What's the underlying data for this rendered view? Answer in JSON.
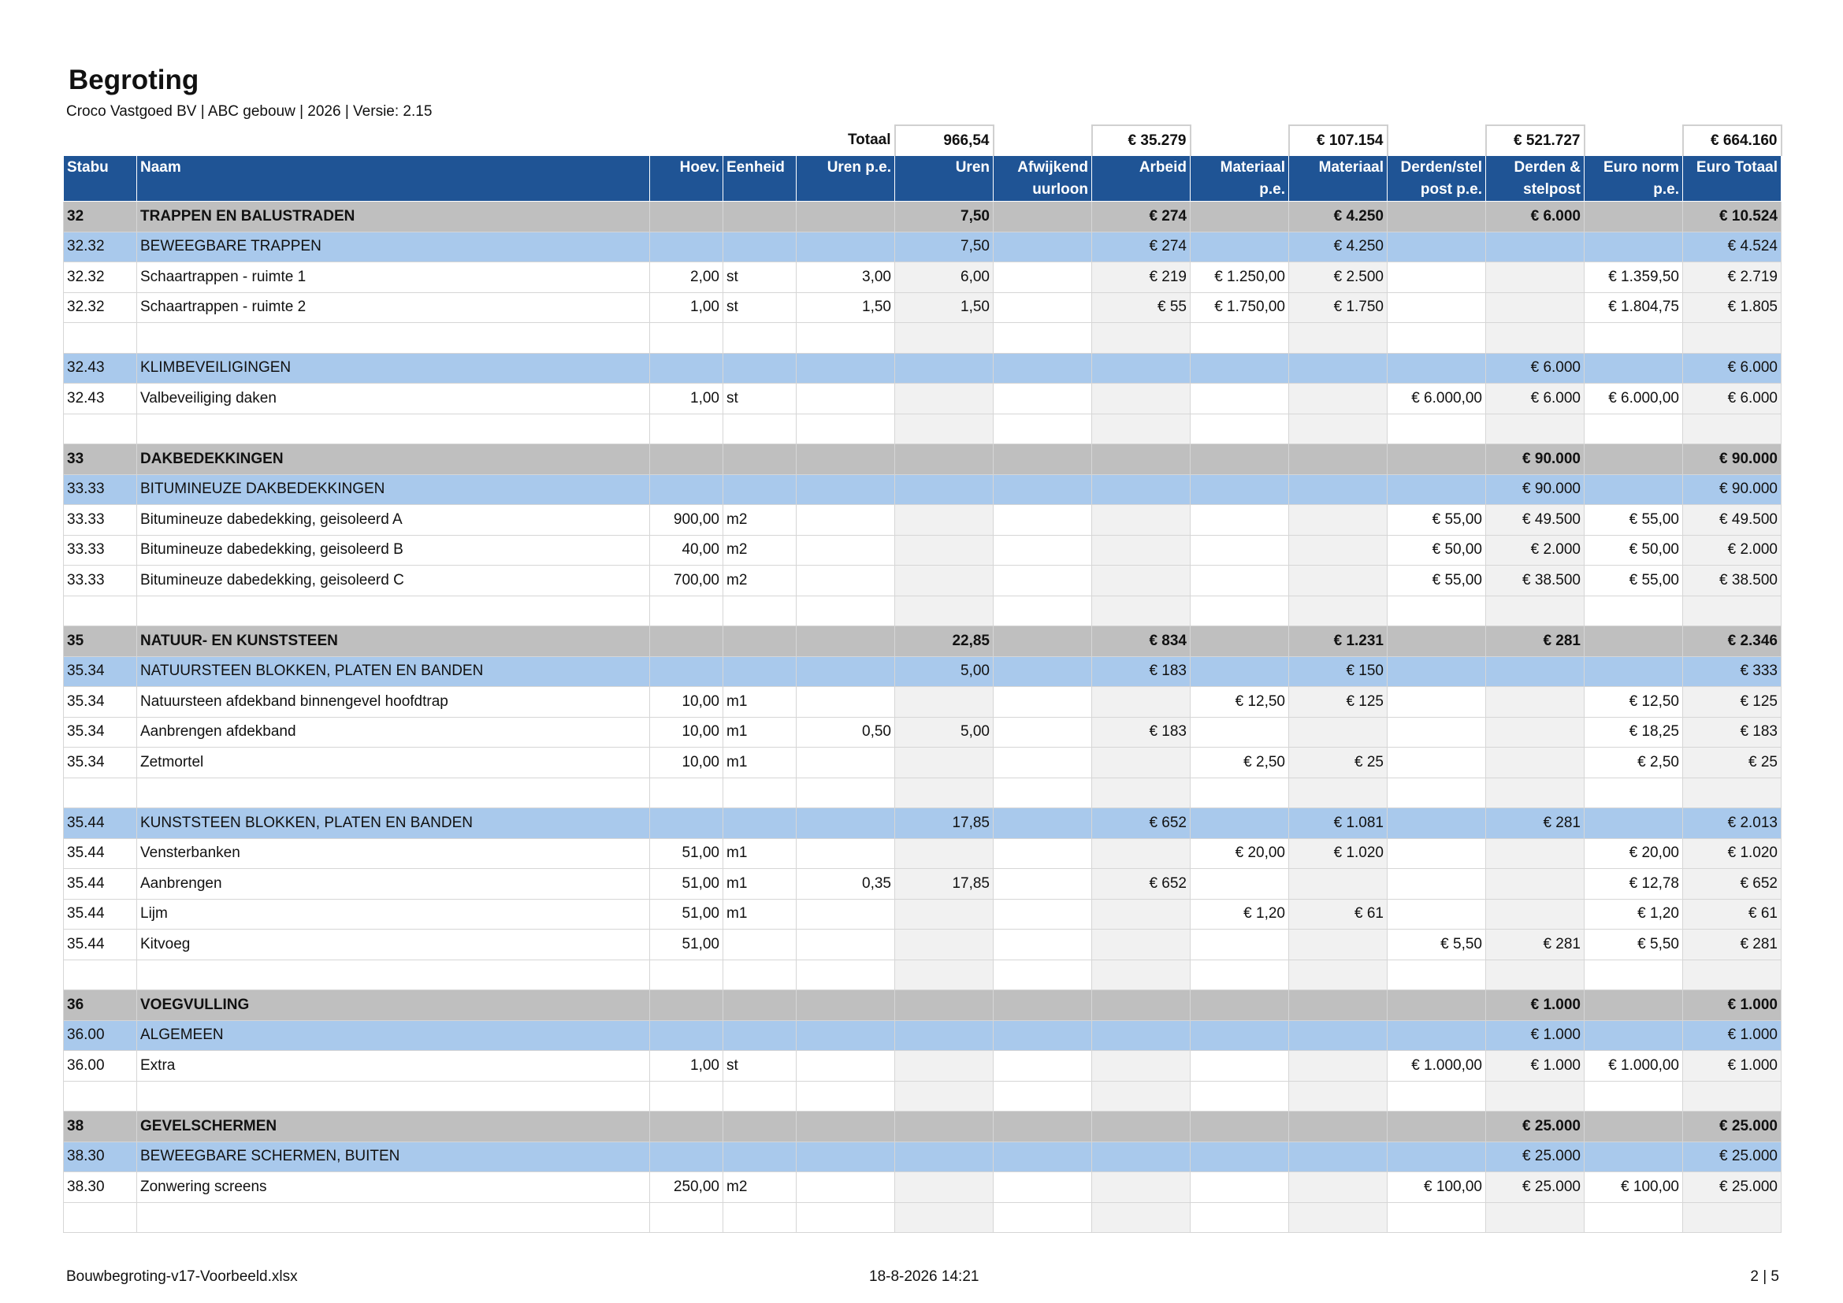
{
  "header": {
    "title": "Begroting",
    "subtitle": "Croco Vastgoed BV | ABC gebouw | 2026 | Versie: 2.15"
  },
  "totals": {
    "label": "Totaal",
    "uren": "966,54",
    "arbeid": "€ 35.279",
    "materiaal": "€ 107.154",
    "derden": "€ 521.727",
    "euro_totaal": "€ 664.160"
  },
  "columns": {
    "stabu": "Stabu",
    "naam": "Naam",
    "hoev": "Hoev.",
    "eenheid": "Eenheid",
    "uren_pe": "Uren p.e.",
    "uren": "Uren",
    "afwijkend_1": "Afwijkend",
    "afwijkend_2": "uurloon",
    "arbeid": "Arbeid",
    "materiaal_pe_1": "Materiaal",
    "materiaal_pe_2": "p.e.",
    "materiaal": "Materiaal",
    "derden_pe_1": "Derden/stel",
    "derden_pe_2": "post p.e.",
    "derden_1": "Derden &",
    "derden_2": "stelpost",
    "euro_norm_1": "Euro norm",
    "euro_norm_2": "p.e.",
    "euro_totaal": "Euro Totaal"
  },
  "rows": [
    {
      "type": "cat",
      "stabu": "32",
      "naam": "TRAPPEN EN BALUSTRADEN",
      "hoev": "",
      "eenheid": "",
      "uren_pe": "",
      "uren": "7,50",
      "afw": "",
      "arbeid": "€ 274",
      "mat_pe": "",
      "mat": "€ 4.250",
      "derden_pe": "",
      "derden": "€ 6.000",
      "norm": "",
      "totaal": "€ 10.524"
    },
    {
      "type": "sub",
      "stabu": "32.32",
      "naam": "BEWEEGBARE TRAPPEN",
      "hoev": "",
      "eenheid": "",
      "uren_pe": "",
      "uren": "7,50",
      "afw": "",
      "arbeid": "€ 274",
      "mat_pe": "",
      "mat": "€ 4.250",
      "derden_pe": "",
      "derden": "",
      "norm": "",
      "totaal": "€ 4.524"
    },
    {
      "type": "item",
      "stabu": "32.32",
      "naam": "Schaartrappen - ruimte 1",
      "hoev": "2,00",
      "eenheid": "st",
      "uren_pe": "3,00",
      "uren": "6,00",
      "afw": "",
      "arbeid": "€ 219",
      "mat_pe": "€ 1.250,00",
      "mat": "€ 2.500",
      "derden_pe": "",
      "derden": "",
      "norm": "€ 1.359,50",
      "totaal": "€ 2.719"
    },
    {
      "type": "item",
      "stabu": "32.32",
      "naam": "Schaartrappen - ruimte 2",
      "hoev": "1,00",
      "eenheid": "st",
      "uren_pe": "1,50",
      "uren": "1,50",
      "afw": "",
      "arbeid": "€ 55",
      "mat_pe": "€ 1.750,00",
      "mat": "€ 1.750",
      "derden_pe": "",
      "derden": "",
      "norm": "€ 1.804,75",
      "totaal": "€ 1.805"
    },
    {
      "type": "blank"
    },
    {
      "type": "sub",
      "stabu": "32.43",
      "naam": "KLIMBEVEILIGINGEN",
      "hoev": "",
      "eenheid": "",
      "uren_pe": "",
      "uren": "",
      "afw": "",
      "arbeid": "",
      "mat_pe": "",
      "mat": "",
      "derden_pe": "",
      "derden": "€ 6.000",
      "norm": "",
      "totaal": "€ 6.000"
    },
    {
      "type": "item",
      "stabu": "32.43",
      "naam": "Valbeveiliging daken",
      "hoev": "1,00",
      "eenheid": "st",
      "uren_pe": "",
      "uren": "",
      "afw": "",
      "arbeid": "",
      "mat_pe": "",
      "mat": "",
      "derden_pe": "€ 6.000,00",
      "derden": "€ 6.000",
      "norm": "€ 6.000,00",
      "totaal": "€ 6.000"
    },
    {
      "type": "blank"
    },
    {
      "type": "cat",
      "stabu": "33",
      "naam": "DAKBEDEKKINGEN",
      "hoev": "",
      "eenheid": "",
      "uren_pe": "",
      "uren": "",
      "afw": "",
      "arbeid": "",
      "mat_pe": "",
      "mat": "",
      "derden_pe": "",
      "derden": "€ 90.000",
      "norm": "",
      "totaal": "€ 90.000"
    },
    {
      "type": "sub",
      "stabu": "33.33",
      "naam": "BITUMINEUZE DAKBEDEKKINGEN",
      "hoev": "",
      "eenheid": "",
      "uren_pe": "",
      "uren": "",
      "afw": "",
      "arbeid": "",
      "mat_pe": "",
      "mat": "",
      "derden_pe": "",
      "derden": "€ 90.000",
      "norm": "",
      "totaal": "€ 90.000"
    },
    {
      "type": "item",
      "stabu": "33.33",
      "naam": "Bitumineuze dabedekking, geisoleerd A",
      "hoev": "900,00",
      "eenheid": "m2",
      "uren_pe": "",
      "uren": "",
      "afw": "",
      "arbeid": "",
      "mat_pe": "",
      "mat": "",
      "derden_pe": "€ 55,00",
      "derden": "€ 49.500",
      "norm": "€ 55,00",
      "totaal": "€ 49.500"
    },
    {
      "type": "item",
      "stabu": "33.33",
      "naam": "Bitumineuze dabedekking, geisoleerd B",
      "hoev": "40,00",
      "eenheid": "m2",
      "uren_pe": "",
      "uren": "",
      "afw": "",
      "arbeid": "",
      "mat_pe": "",
      "mat": "",
      "derden_pe": "€ 50,00",
      "derden": "€ 2.000",
      "norm": "€ 50,00",
      "totaal": "€ 2.000"
    },
    {
      "type": "item",
      "stabu": "33.33",
      "naam": "Bitumineuze dabedekking, geisoleerd C",
      "hoev": "700,00",
      "eenheid": "m2",
      "uren_pe": "",
      "uren": "",
      "afw": "",
      "arbeid": "",
      "mat_pe": "",
      "mat": "",
      "derden_pe": "€ 55,00",
      "derden": "€ 38.500",
      "norm": "€ 55,00",
      "totaal": "€ 38.500"
    },
    {
      "type": "blank"
    },
    {
      "type": "cat",
      "stabu": "35",
      "naam": "NATUUR- EN KUNSTSTEEN",
      "hoev": "",
      "eenheid": "",
      "uren_pe": "",
      "uren": "22,85",
      "afw": "",
      "arbeid": "€ 834",
      "mat_pe": "",
      "mat": "€ 1.231",
      "derden_pe": "",
      "derden": "€ 281",
      "norm": "",
      "totaal": "€ 2.346"
    },
    {
      "type": "sub",
      "stabu": "35.34",
      "naam": "NATUURSTEEN BLOKKEN, PLATEN EN BANDEN",
      "hoev": "",
      "eenheid": "",
      "uren_pe": "",
      "uren": "5,00",
      "afw": "",
      "arbeid": "€ 183",
      "mat_pe": "",
      "mat": "€ 150",
      "derden_pe": "",
      "derden": "",
      "norm": "",
      "totaal": "€ 333"
    },
    {
      "type": "item",
      "stabu": "35.34",
      "naam": "Natuursteen afdekband binnengevel hoofdtrap",
      "hoev": "10,00",
      "eenheid": "m1",
      "uren_pe": "",
      "uren": "",
      "afw": "",
      "arbeid": "",
      "mat_pe": "€ 12,50",
      "mat": "€ 125",
      "derden_pe": "",
      "derden": "",
      "norm": "€ 12,50",
      "totaal": "€ 125"
    },
    {
      "type": "item",
      "stabu": "35.34",
      "naam": "Aanbrengen afdekband",
      "hoev": "10,00",
      "eenheid": "m1",
      "uren_pe": "0,50",
      "uren": "5,00",
      "afw": "",
      "arbeid": "€ 183",
      "mat_pe": "",
      "mat": "",
      "derden_pe": "",
      "derden": "",
      "norm": "€ 18,25",
      "totaal": "€ 183"
    },
    {
      "type": "item",
      "stabu": "35.34",
      "naam": "Zetmortel",
      "hoev": "10,00",
      "eenheid": "m1",
      "uren_pe": "",
      "uren": "",
      "afw": "",
      "arbeid": "",
      "mat_pe": "€ 2,50",
      "mat": "€ 25",
      "derden_pe": "",
      "derden": "",
      "norm": "€ 2,50",
      "totaal": "€ 25"
    },
    {
      "type": "blank"
    },
    {
      "type": "sub",
      "stabu": "35.44",
      "naam": "KUNSTSTEEN BLOKKEN, PLATEN EN BANDEN",
      "hoev": "",
      "eenheid": "",
      "uren_pe": "",
      "uren": "17,85",
      "afw": "",
      "arbeid": "€ 652",
      "mat_pe": "",
      "mat": "€ 1.081",
      "derden_pe": "",
      "derden": "€ 281",
      "norm": "",
      "totaal": "€ 2.013"
    },
    {
      "type": "item",
      "stabu": "35.44",
      "naam": "Vensterbanken",
      "hoev": "51,00",
      "eenheid": "m1",
      "uren_pe": "",
      "uren": "",
      "afw": "",
      "arbeid": "",
      "mat_pe": "€ 20,00",
      "mat": "€ 1.020",
      "derden_pe": "",
      "derden": "",
      "norm": "€ 20,00",
      "totaal": "€ 1.020"
    },
    {
      "type": "item",
      "stabu": "35.44",
      "naam": "Aanbrengen",
      "hoev": "51,00",
      "eenheid": "m1",
      "uren_pe": "0,35",
      "uren": "17,85",
      "afw": "",
      "arbeid": "€ 652",
      "mat_pe": "",
      "mat": "",
      "derden_pe": "",
      "derden": "",
      "norm": "€ 12,78",
      "totaal": "€ 652"
    },
    {
      "type": "item",
      "stabu": "35.44",
      "naam": "Lijm",
      "hoev": "51,00",
      "eenheid": "m1",
      "uren_pe": "",
      "uren": "",
      "afw": "",
      "arbeid": "",
      "mat_pe": "€ 1,20",
      "mat": "€ 61",
      "derden_pe": "",
      "derden": "",
      "norm": "€ 1,20",
      "totaal": "€ 61"
    },
    {
      "type": "item",
      "stabu": "35.44",
      "naam": "Kitvoeg",
      "hoev": "51,00",
      "eenheid": "",
      "uren_pe": "",
      "uren": "",
      "afw": "",
      "arbeid": "",
      "mat_pe": "",
      "mat": "",
      "derden_pe": "€ 5,50",
      "derden": "€ 281",
      "norm": "€ 5,50",
      "totaal": "€ 281"
    },
    {
      "type": "blank"
    },
    {
      "type": "cat",
      "stabu": "36",
      "naam": "VOEGVULLING",
      "hoev": "",
      "eenheid": "",
      "uren_pe": "",
      "uren": "",
      "afw": "",
      "arbeid": "",
      "mat_pe": "",
      "mat": "",
      "derden_pe": "",
      "derden": "€ 1.000",
      "norm": "",
      "totaal": "€ 1.000"
    },
    {
      "type": "sub",
      "stabu": "36.00",
      "naam": "ALGEMEEN",
      "hoev": "",
      "eenheid": "",
      "uren_pe": "",
      "uren": "",
      "afw": "",
      "arbeid": "",
      "mat_pe": "",
      "mat": "",
      "derden_pe": "",
      "derden": "€ 1.000",
      "norm": "",
      "totaal": "€ 1.000"
    },
    {
      "type": "item",
      "stabu": "36.00",
      "naam": "Extra",
      "hoev": "1,00",
      "eenheid": "st",
      "uren_pe": "",
      "uren": "",
      "afw": "",
      "arbeid": "",
      "mat_pe": "",
      "mat": "",
      "derden_pe": "€ 1.000,00",
      "derden": "€ 1.000",
      "norm": "€ 1.000,00",
      "totaal": "€ 1.000"
    },
    {
      "type": "blank"
    },
    {
      "type": "cat",
      "stabu": "38",
      "naam": "GEVELSCHERMEN",
      "hoev": "",
      "eenheid": "",
      "uren_pe": "",
      "uren": "",
      "afw": "",
      "arbeid": "",
      "mat_pe": "",
      "mat": "",
      "derden_pe": "",
      "derden": "€ 25.000",
      "norm": "",
      "totaal": "€ 25.000"
    },
    {
      "type": "sub",
      "stabu": "38.30",
      "naam": "BEWEEGBARE SCHERMEN, BUITEN",
      "hoev": "",
      "eenheid": "",
      "uren_pe": "",
      "uren": "",
      "afw": "",
      "arbeid": "",
      "mat_pe": "",
      "mat": "",
      "derden_pe": "",
      "derden": "€ 25.000",
      "norm": "",
      "totaal": "€ 25.000"
    },
    {
      "type": "item",
      "stabu": "38.30",
      "naam": "Zonwering screens",
      "hoev": "250,00",
      "eenheid": "m2",
      "uren_pe": "",
      "uren": "",
      "afw": "",
      "arbeid": "",
      "mat_pe": "",
      "mat": "",
      "derden_pe": "€ 100,00",
      "derden": "€ 25.000",
      "norm": "€ 100,00",
      "totaal": "€ 25.000"
    },
    {
      "type": "blank"
    }
  ],
  "footer": {
    "filename": "Bouwbegroting-v17-Voorbeeld.xlsx",
    "datetime": "18-8-2026 14:21",
    "page": "2 | 5"
  }
}
